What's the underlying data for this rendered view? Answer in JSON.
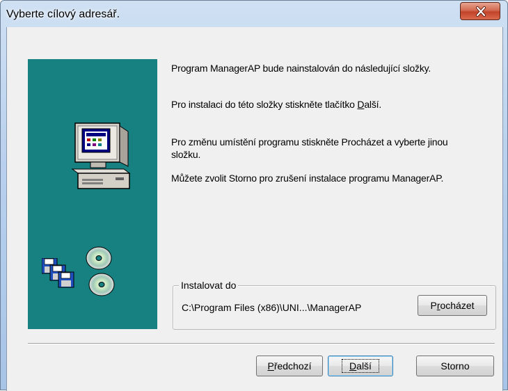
{
  "window": {
    "title": "Vyberte cílový adresář."
  },
  "content": {
    "line1": "Program ManagerAP bude nainstalován do následující složky.",
    "line2_pre": "Pro instalaci do této složky  stiskněte tlačítko ",
    "line2_link": "D",
    "line2_post": "alší.",
    "line3a": "Pro změnu umístění programu stiskněte Procházet a vyberte jinou",
    "line3b": "složku.",
    "line4": "Můžete zvolit Storno pro zrušení instalace programu ManagerAP."
  },
  "install_group": {
    "legend": "Instalovat do",
    "path": "C:\\Program Files (x86)\\UNI...\\ManagerAP",
    "browse_pre": "P",
    "browse_u": "r",
    "browse_post": "ocházet"
  },
  "buttons": {
    "back_u": "P",
    "back_post": "ředchozí",
    "next_u": "D",
    "next_post": "alší",
    "cancel": "Storno"
  },
  "colors": {
    "panel": "#178080",
    "close_button": "#c7452b"
  },
  "icons": [
    "close-icon",
    "computer-icon",
    "floppy-disks-icon",
    "cd-disc-icon"
  ]
}
